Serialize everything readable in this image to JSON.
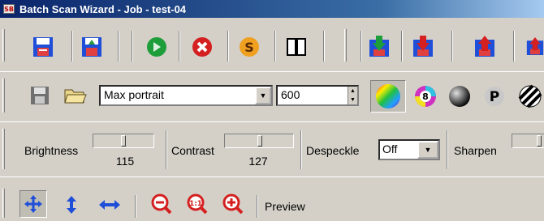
{
  "window": {
    "title": "Batch Scan Wizard - Job - test-04",
    "app_icon": "SB"
  },
  "toolbar2": {
    "profile_value": "Max portrait",
    "dpi_value": "600"
  },
  "toolbar3": {
    "brightness_label": "Brightness",
    "brightness_value": "115",
    "contrast_label": "Contrast",
    "contrast_value": "127",
    "despeckle_label": "Despeckle",
    "despeckle_value": "Off",
    "sharpen_label": "Sharpen"
  },
  "toolbar4": {
    "preview_label": "Preview"
  },
  "colors": {
    "title_start": "#0a246a",
    "title_end": "#a6caf0",
    "toolbar_bg": "#d4d0c8",
    "accent_blue": "#1f4fd8",
    "accent_red": "#d42020",
    "accent_green": "#1e9e3a"
  }
}
